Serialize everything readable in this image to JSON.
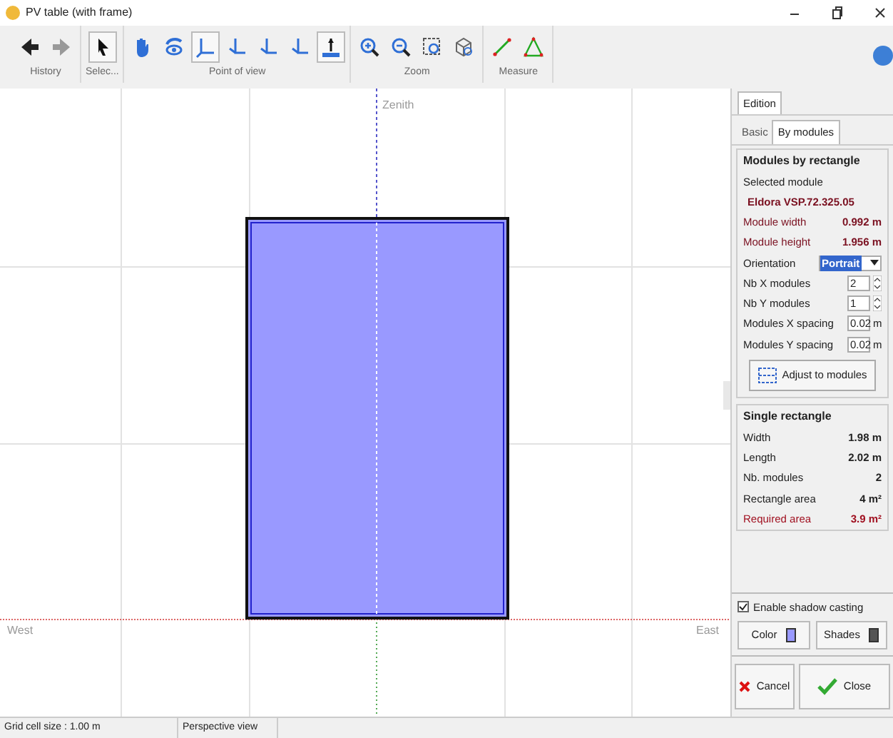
{
  "window": {
    "title": "PV table (with frame)"
  },
  "toolbar": {
    "groups": [
      {
        "label": "History",
        "tools": [
          {
            "kind": "back",
            "selected": false
          },
          {
            "kind": "forward",
            "selected": false
          }
        ]
      },
      {
        "label": "Selec...",
        "tools": [
          {
            "kind": "pointer",
            "selected": true
          }
        ]
      },
      {
        "label": "Point of view",
        "tools": [
          {
            "kind": "hand",
            "selected": false
          },
          {
            "kind": "orbit",
            "selected": false
          },
          {
            "kind": "axes",
            "selected": true
          },
          {
            "kind": "axes_xy",
            "selected": false
          },
          {
            "kind": "axes_xz",
            "selected": false
          },
          {
            "kind": "axes_zy",
            "selected": false
          },
          {
            "kind": "top",
            "selected": true
          }
        ]
      },
      {
        "label": "Zoom",
        "tools": [
          {
            "kind": "zoom_in",
            "selected": false
          },
          {
            "kind": "zoom_out",
            "selected": false
          },
          {
            "kind": "zoom_box",
            "selected": false
          },
          {
            "kind": "zoom_all",
            "selected": false
          }
        ]
      },
      {
        "label": "Measure",
        "tools": [
          {
            "kind": "measure_line",
            "selected": false
          },
          {
            "kind": "measure_triangle",
            "selected": false
          }
        ]
      }
    ]
  },
  "canvas": {
    "labels": [
      {
        "kind": "top",
        "text": "Zenith"
      },
      {
        "kind": "left",
        "text": "West"
      },
      {
        "kind": "right",
        "text": "East"
      }
    ]
  },
  "panel": {
    "tabs": [
      {
        "label": "Edition",
        "selected": true
      }
    ],
    "subtabs": [
      {
        "label": "Basic",
        "selected": false
      },
      {
        "label": "By modules",
        "selected": true
      }
    ],
    "modules_group": {
      "title": "Modules by rectangle",
      "selected_label": "Selected module",
      "selected_module": "Eldora VSP.72.325.05",
      "dims": [
        {
          "label": "Module width",
          "value": "0.992 m"
        },
        {
          "label": "Module height",
          "value": "1.956 m"
        }
      ],
      "orientation": {
        "label": "Orientation",
        "value": "Portrait"
      },
      "fields": [
        {
          "kind": "spin",
          "label": "Nb X modules",
          "value": "2"
        },
        {
          "kind": "spin",
          "label": "Nb Y modules",
          "value": "1"
        },
        {
          "kind": "unit",
          "label": "Modules X spacing",
          "value": "0.02",
          "unit": "m"
        },
        {
          "kind": "unit",
          "label": "Modules Y spacing",
          "value": "0.02",
          "unit": "m"
        }
      ],
      "button": "Adjust to modules"
    },
    "rect_group": {
      "title": "Single rectangle",
      "rows": [
        {
          "label": "Width",
          "value": "1.98 m",
          "warning": false
        },
        {
          "label": "Length",
          "value": "2.02 m",
          "warning": false
        },
        {
          "label": "Nb. modules",
          "value": "2",
          "warning": false
        },
        {
          "label": "Rectangle area",
          "value": "4 m²",
          "warning": false
        },
        {
          "label": "Required area",
          "value": "3.9 m²",
          "warning": true
        }
      ]
    },
    "shadow": {
      "label": "Enable shadow casting",
      "checked": true
    },
    "color_buttons": [
      {
        "label": "Color",
        "color": "#9999ff"
      },
      {
        "label": "Shades",
        "color": "#555555"
      }
    ],
    "actions": [
      {
        "kind": "cancel",
        "label": "Cancel"
      },
      {
        "kind": "close",
        "label": "Close"
      }
    ]
  },
  "status_bar": [
    "Grid cell size : 1.00 m",
    "Perspective view"
  ]
}
